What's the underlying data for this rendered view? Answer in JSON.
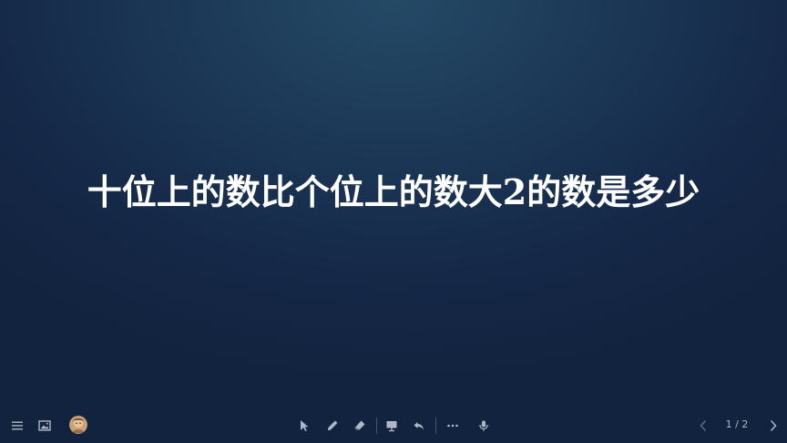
{
  "slide": {
    "title": "十位上的数比个位上的数大2的数是多少"
  },
  "toolbar": {
    "left_icons": [
      "menu-icon",
      "picture-icon",
      "avatar"
    ],
    "center_icons": [
      "pointer-icon",
      "pen-icon",
      "eraser-icon",
      "presentation-icon",
      "undo-icon",
      "more-icon",
      "mic-icon"
    ],
    "right_icons": [
      "prev-icon",
      "next-icon"
    ],
    "page_indicator": "1 / 2"
  },
  "colors": {
    "background_top": "#244a66",
    "background_bottom": "#12233f",
    "title_text": "#ffffff",
    "icon": "#aeb7c6"
  }
}
